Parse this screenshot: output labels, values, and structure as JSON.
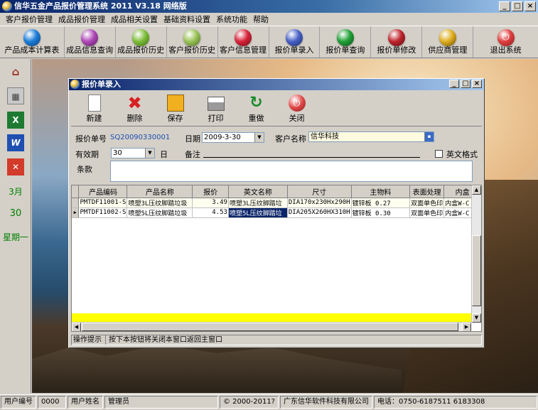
{
  "app": {
    "title": "信华五金产品报价管理系统 2011 V3.18 网络版",
    "win_min": "_",
    "win_max": "□",
    "win_close": "×"
  },
  "menu": [
    "客户报价管理",
    "成品报价管理",
    "成品相关设置",
    "基础资料设置",
    "系统功能",
    "帮助"
  ],
  "toolbar": [
    {
      "label": "产品成本计算表",
      "color": "#1d7ed8",
      "icon": "blue-orb-icon"
    },
    {
      "label": "成品信息查询",
      "color": "#b04ab8",
      "icon": "purple-orb-icon"
    },
    {
      "label": "成品报价历史",
      "color": "#7fbf3a",
      "icon": "green-orb-icon"
    },
    {
      "label": "客户报价历史",
      "color": "#9cc45a",
      "icon": "lime-orb-icon"
    },
    {
      "label": "客户信息管理",
      "color": "#d8243a",
      "icon": "red-orb-icon"
    },
    {
      "label": "报价单录入",
      "color": "#4a62c8",
      "icon": "indigo-orb-icon"
    },
    {
      "label": "报价单查询",
      "color": "#22a23a",
      "icon": "green-orb-icon"
    },
    {
      "label": "报价单修改",
      "color": "#c0262e",
      "icon": "crimson-orb-icon"
    },
    {
      "label": "供应商管理",
      "color": "#e0b020",
      "icon": "gold-orb-icon"
    },
    {
      "label": "退出系统",
      "color": "#e04040",
      "icon": "power-icon"
    }
  ],
  "sidebar": {
    "month": "3月",
    "day": "30",
    "weekday": "星期一"
  },
  "dialog": {
    "title": "报价单录入",
    "toolbar": [
      {
        "label": "新建",
        "icon": "new-document-icon"
      },
      {
        "label": "删除",
        "icon": "delete-x-icon"
      },
      {
        "label": "保存",
        "icon": "save-floppy-icon"
      },
      {
        "label": "打印",
        "icon": "printer-icon"
      },
      {
        "label": "重做",
        "icon": "redo-icon"
      },
      {
        "label": "关闭",
        "icon": "close-power-icon"
      }
    ],
    "form": {
      "quote_no_label": "报价单号",
      "quote_no": "SQ20090330001",
      "date_label": "日期",
      "date": "2009-3-30",
      "customer_label": "客户名称",
      "customer": "信华科技",
      "validity_label": "有效期",
      "validity": "30",
      "validity_unit": "日",
      "remark_label": "备注",
      "english_label": "英文格式",
      "terms_label": "条款"
    },
    "grid": {
      "columns": [
        "产品编码",
        "产品名称",
        "报价",
        "英文名称",
        "尺寸",
        "主物料",
        "表面处理",
        "内盒"
      ],
      "rows": [
        [
          "PMTDF11001-S",
          "喷塑3L压纹脚踏垃圾",
          "3.49",
          "喷塑3L压纹脚踏垃",
          "DIA170x230Hx290H",
          "镀锌板 0.27",
          "双面单色印",
          "内盒W-C"
        ],
        [
          "PMTDF11002-S",
          "喷塑5L压纹脚踏垃圾",
          "4.53",
          "喷塑5L压纹脚踏垃",
          "DIA205X260HX310H",
          "镀锌板 0.30",
          "双面单色印",
          "内盒W-C"
        ]
      ]
    },
    "hint_label": "操作提示",
    "hint_text": "按下本按钮将关闭本窗口返回主窗口"
  },
  "status": {
    "user_no_label": "用户编号",
    "user_no": "0000",
    "user_name_label": "用户姓名",
    "user_name": "管理员",
    "copyright": "© 2000-2011?",
    "company": "广东信华软件科技有限公司",
    "phone": "电话：0750-6187511  6183308"
  }
}
